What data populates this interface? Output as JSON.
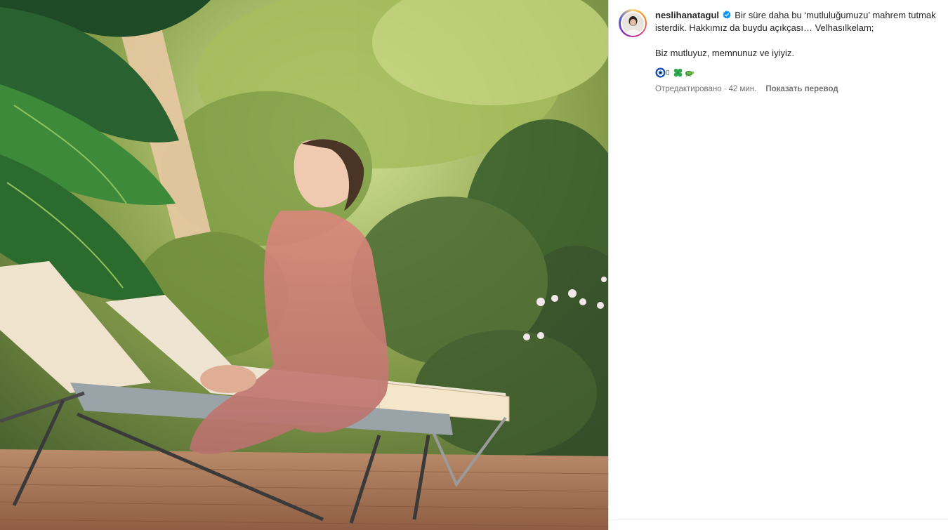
{
  "post": {
    "username": "neslihanatagul",
    "verified_icon": "verified-badge-icon",
    "caption_line1": "Bir süre daha bu ‘mutluluğumuzu’ mahrem tutmak isterdik. Hakkımız da buydu açıkçası… Velhasılkelam;",
    "caption_line2": "Biz mutluyuz, memnunuz ve iyiyiz.",
    "emojis": [
      "nazar-amulet-icon",
      "placeholder-glyph-icon",
      "four-leaf-clover-icon",
      "turtle-icon"
    ],
    "edited_label": "Отредактировано",
    "separator": "·",
    "time_ago": "42 мин.",
    "translate_label": "Показать перевод"
  },
  "colors": {
    "verified_blue": "#0095f6",
    "text_primary": "#262626",
    "text_secondary": "#737373"
  }
}
